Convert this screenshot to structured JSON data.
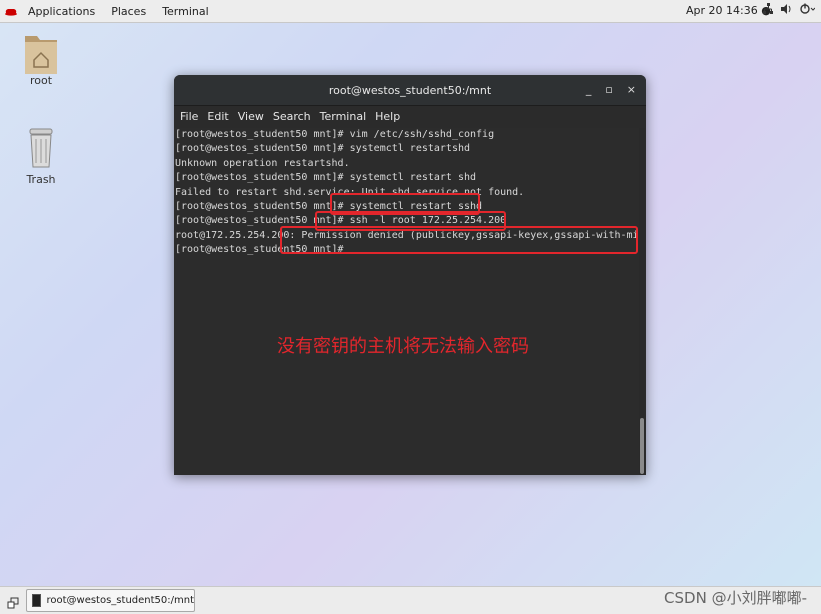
{
  "topbar": {
    "applications": "Applications",
    "places": "Places",
    "terminal": "Terminal",
    "clock": "Apr 20  14:36 ●",
    "tray_icons": [
      "network-icon",
      "volume-icon",
      "power-icon"
    ]
  },
  "desktop": {
    "root_label": "root",
    "trash_label": "Trash"
  },
  "window": {
    "title": "root@westos_student50:/mnt",
    "menu": [
      "File",
      "Edit",
      "View",
      "Search",
      "Terminal",
      "Help"
    ],
    "lines": [
      "[root@westos_student50 mnt]# vim /etc/ssh/sshd_config",
      "[root@westos_student50 mnt]# systemctl restartshd",
      "Unknown operation restartshd.",
      "[root@westos_student50 mnt]# systemctl restart shd",
      "Failed to restart shd.service: Unit shd.service not found.",
      "[root@westos_student50 mnt]# systemctl restart sshd",
      "[root@westos_student50 mnt]# ssh -l root 172.25.254.200",
      "root@172.25.254.200: Permission denied (publickey,gssapi-keyex,gssapi-with-mic)",
      "[root@westos_student50 mnt]# "
    ]
  },
  "annotation": {
    "text": "没有密钥的主机将无法输入密码",
    "color": "#e3262c"
  },
  "taskbar": {
    "window_label": "root@westos_student50:/mnt",
    "watermark": "CSDN @小刘胖嘟嘟-"
  }
}
